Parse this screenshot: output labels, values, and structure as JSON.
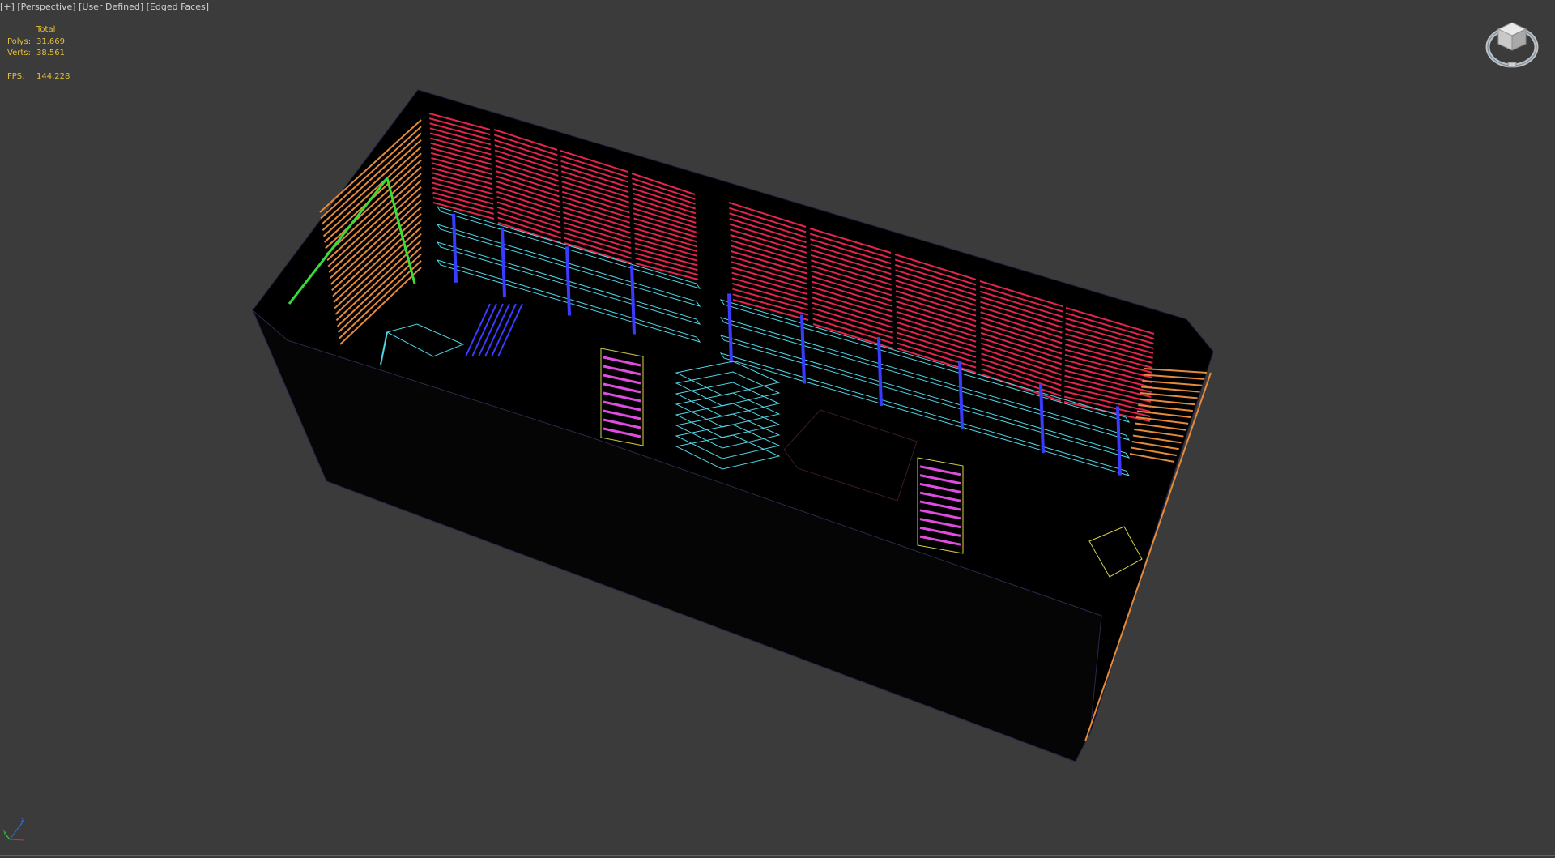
{
  "viewport": {
    "label_items": [
      {
        "name": "viewport-plus-menu",
        "text": "[+]"
      },
      {
        "name": "viewport-point-of-view-menu",
        "text": "[Perspective]"
      },
      {
        "name": "viewport-shading-menu",
        "text": "[User Defined]"
      },
      {
        "name": "viewport-edged-faces-menu",
        "text": "[Edged Faces]"
      }
    ],
    "background_color": "#3b3b3b"
  },
  "stats": {
    "header": "Total",
    "polys_label": "Polys:",
    "polys_value": "31.669",
    "verts_label": "Verts:",
    "verts_value": "38.561",
    "fps_label": "FPS:",
    "fps_value": "144,228",
    "color": "#e3c13b"
  },
  "icons": {
    "viewcube": "viewcube-icon",
    "axis": "axis-tripod-icon"
  },
  "colors": {
    "wire_red": "#e2254b",
    "wire_green": "#3adc3a",
    "wire_cyan": "#4fd7e6",
    "wire_blue": "#3b3bff",
    "wire_magenta": "#e04be0",
    "wire_yellow": "#d8d34b",
    "wire_orange": "#e48a3c"
  }
}
